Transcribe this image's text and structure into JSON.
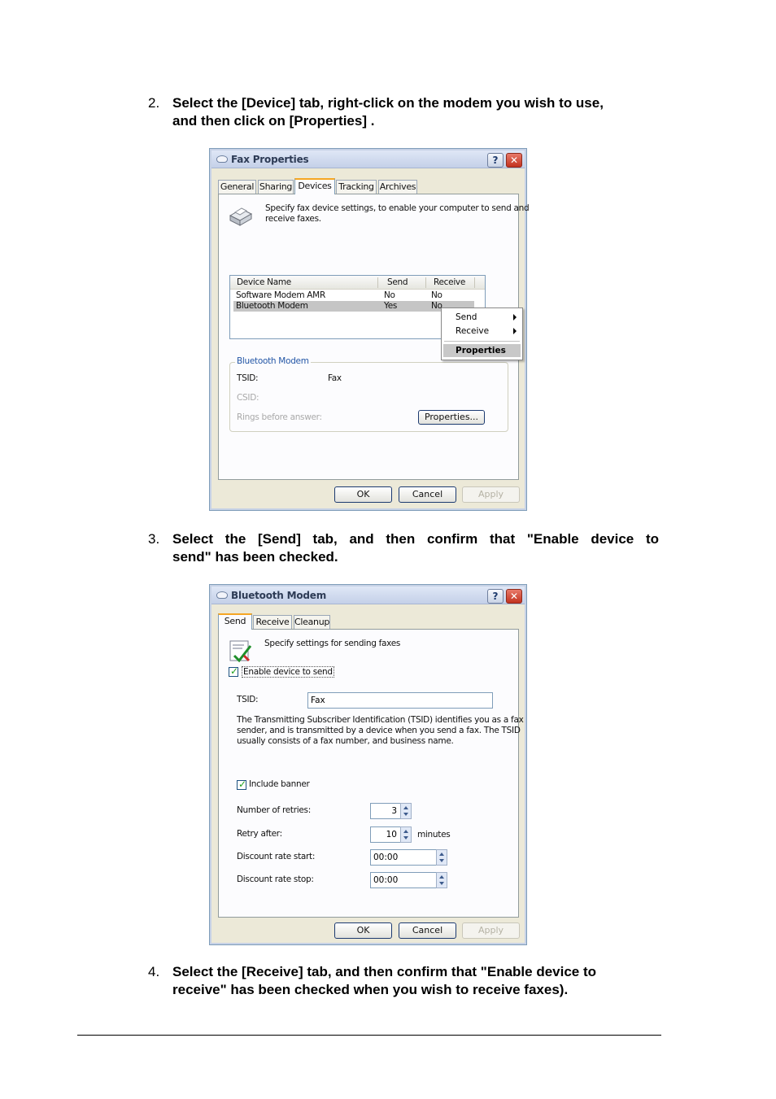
{
  "steps": [
    {
      "number": "2.",
      "text_line1": "Select the [Device] tab, right-click on the modem you wish to use,",
      "text_line2": "and then click on [Properties] ."
    },
    {
      "number": "3.",
      "text_line1": "Select the [Send] tab, and then confirm that \"Enable device to",
      "text_line2": "send\" has been checked."
    },
    {
      "number": "4.",
      "text_line1": "Select the [Receive] tab, and then confirm that \"Enable device to",
      "text_line2": "receive\" has been checked when you wish to receive faxes)."
    }
  ],
  "fax_dialog": {
    "title": "Fax Properties",
    "help_label": "?",
    "close_label": "✕",
    "tabs": [
      "General",
      "Sharing",
      "Devices",
      "Tracking",
      "Archives"
    ],
    "active_tab": "Devices",
    "description_line1": "Specify fax device settings, to enable your computer to send and",
    "description_line2": "receive faxes.",
    "columns": [
      "Device Name",
      "Send",
      "Receive"
    ],
    "rows": [
      {
        "name": "Software Modem AMR",
        "send": "No",
        "receive": "No"
      },
      {
        "name": "Bluetooth Modem",
        "send": "Yes",
        "receive": "No"
      }
    ],
    "context_menu": {
      "send": "Send",
      "receive": "Receive",
      "properties": "Properties"
    },
    "group_title": "Bluetooth Modem",
    "tsid_label": "TSID:",
    "tsid_value": "Fax",
    "csid_label": "CSID:",
    "rings_label": "Rings before answer:",
    "properties_button": "Properties...",
    "ok": "OK",
    "cancel": "Cancel",
    "apply": "Apply"
  },
  "bt_dialog": {
    "title": "Bluetooth Modem",
    "help_label": "?",
    "close_label": "✕",
    "tabs": [
      "Send",
      "Receive",
      "Cleanup"
    ],
    "active_tab": "Send",
    "description": "Specify settings for sending faxes",
    "enable_send": "Enable device to send",
    "tsid_label": "TSID:",
    "tsid_value": "Fax",
    "tsid_info_line1": "The Transmitting Subscriber Identification (TSID) identifies you as a fax",
    "tsid_info_line2": "sender, and is transmitted by a device when you send a fax. The TSID",
    "tsid_info_line3": "usually consists of a fax number, and business name.",
    "include_banner": "Include banner",
    "retries_label": "Number of retries:",
    "retries_value": "3",
    "retry_after_label": "Retry after:",
    "retry_after_value": "10",
    "minutes_label": "minutes",
    "discount_start_label": "Discount rate start:",
    "discount_start_value": "00:00",
    "discount_stop_label": "Discount rate stop:",
    "discount_stop_value": "00:00",
    "ok": "OK",
    "cancel": "Cancel",
    "apply": "Apply"
  }
}
